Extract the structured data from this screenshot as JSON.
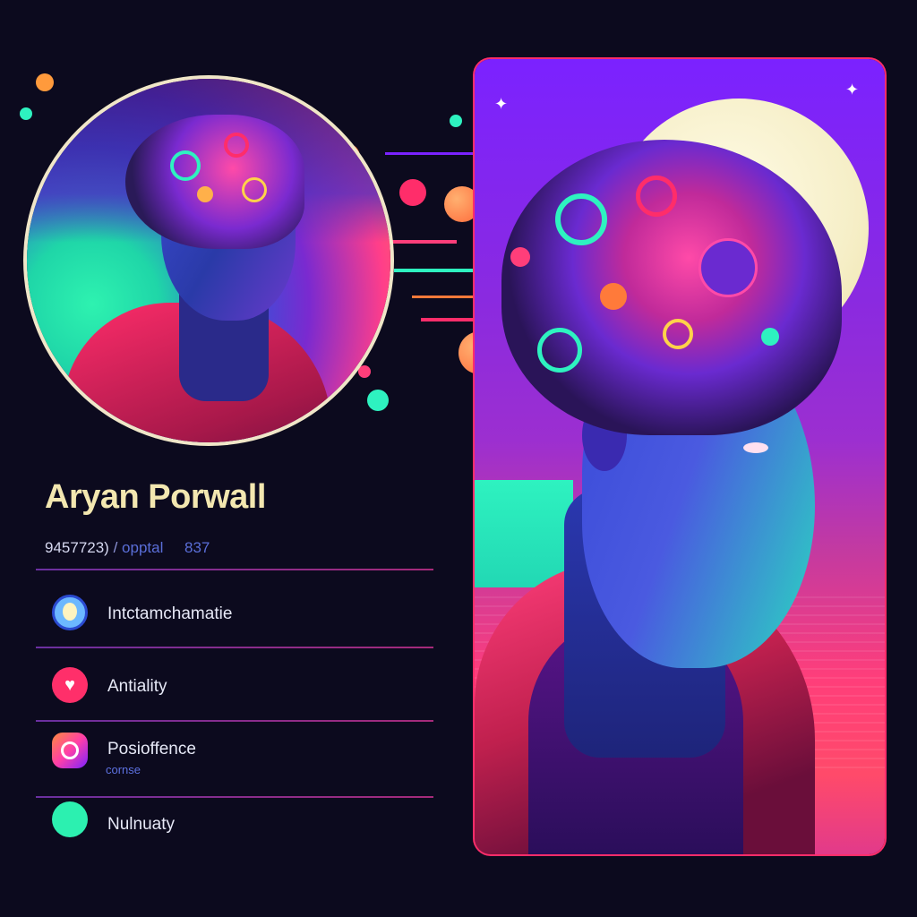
{
  "profile": {
    "name": "Aryan Porwall",
    "meta": {
      "number": "9457723)",
      "separator": "/",
      "handle": "opptal",
      "count": "837"
    }
  },
  "rows": [
    {
      "label": "Intctamchamatie",
      "icon": "face-icon",
      "color": "#6cb8ff"
    },
    {
      "label": "Antiality",
      "icon": "heart-icon",
      "color": "#ff2f6a"
    },
    {
      "label": "Posioffence",
      "sub": "cornse",
      "icon": "camera-icon",
      "color": "#ff3fa8"
    },
    {
      "label": "Nulnuaty",
      "icon": "circle-icon",
      "color": "#2cf0b0"
    }
  ],
  "colors": {
    "background": "#0c0a1e",
    "accent_pink": "#ff2d6a",
    "accent_purple": "#7b22ff",
    "accent_mint": "#2ef2b0",
    "name_color": "#f3e7b0"
  }
}
